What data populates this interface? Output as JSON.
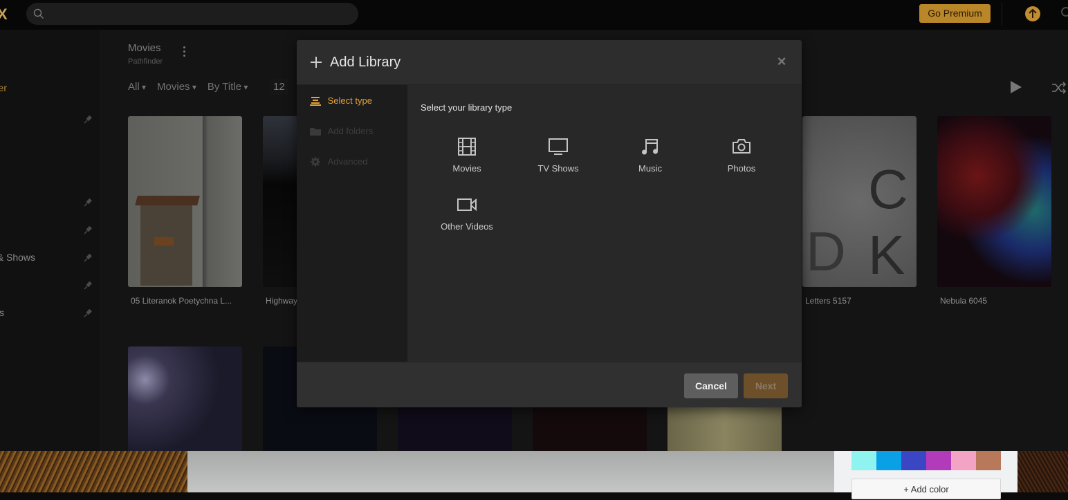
{
  "topbar": {
    "logo": "X",
    "search_placeholder": "",
    "premium_label": "Go Premium",
    "upload_icon": "arrow-up-circle-icon"
  },
  "sidebar": {
    "items": [
      {
        "label": "er",
        "active": true,
        "pinned": false
      },
      {
        "label": "",
        "pinned": true
      },
      {
        "label": "",
        "pinned": true
      },
      {
        "label": "",
        "pinned": true
      },
      {
        "label": "& Shows",
        "pinned": true
      },
      {
        "label": "",
        "pinned": true
      },
      {
        "label": "s",
        "pinned": true
      }
    ]
  },
  "library_header": {
    "title": "Movies",
    "subtitle": "Pathfinder",
    "filters": [
      "All",
      "Movies",
      "By Title"
    ],
    "count": "12"
  },
  "posters": [
    {
      "title": "05 Literanok Poetychna L..."
    },
    {
      "title": "Highway"
    },
    {
      "title": "Letters 5157"
    },
    {
      "title": "Nebula 6045"
    }
  ],
  "modal": {
    "title": "Add Library",
    "close_label": "×",
    "steps": [
      {
        "label": "Select type",
        "state": "active",
        "icon": "list-icon"
      },
      {
        "label": "Add folders",
        "state": "disabled",
        "icon": "folder-icon"
      },
      {
        "label": "Advanced",
        "state": "disabled",
        "icon": "gear-icon"
      }
    ],
    "prompt": "Select your library type",
    "types": [
      {
        "label": "Movies",
        "icon": "film-icon"
      },
      {
        "label": "TV Shows",
        "icon": "tv-icon"
      },
      {
        "label": "Music",
        "icon": "music-note-icon"
      },
      {
        "label": "Photos",
        "icon": "camera-icon"
      },
      {
        "label": "Other Videos",
        "icon": "video-camera-icon"
      }
    ],
    "cancel_label": "Cancel",
    "next_label": "Next"
  },
  "color_panel": {
    "swatches": [
      "#8ff3f0",
      "#0aa0e6",
      "#3b46c4",
      "#b23bba",
      "#f3a3c4",
      "#b8785a"
    ],
    "add_color_label": "+ Add color"
  }
}
